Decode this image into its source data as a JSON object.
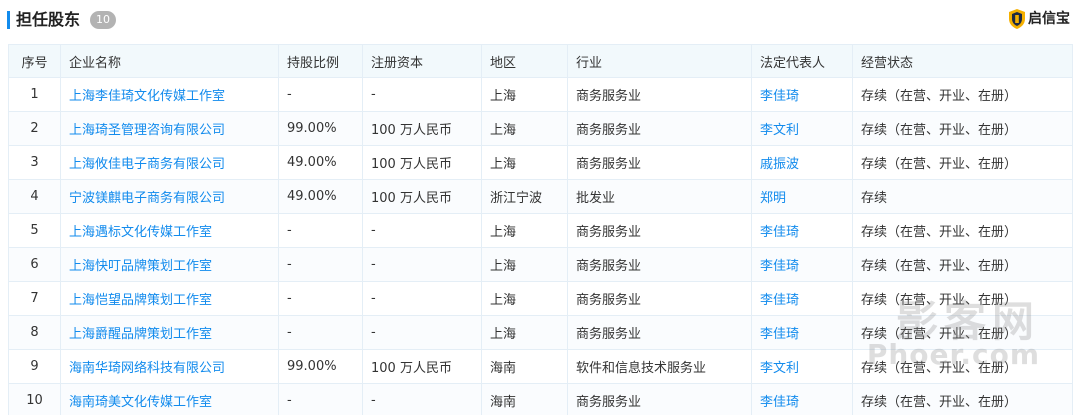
{
  "section": {
    "title": "担任股东",
    "count": "10"
  },
  "brand": {
    "name": "启信宝",
    "icon": "shield-icon",
    "color": "#f5b000"
  },
  "table": {
    "columns": [
      "序号",
      "企业名称",
      "持股比例",
      "注册资本",
      "地区",
      "行业",
      "法定代表人",
      "经营状态"
    ],
    "rows": [
      {
        "idx": "1",
        "company": "上海李佳琦文化传媒工作室",
        "ratio": "-",
        "capital": "-",
        "region": "上海",
        "industry": "商务服务业",
        "legal": "李佳琦",
        "status": "存续（在营、开业、在册）"
      },
      {
        "idx": "2",
        "company": "上海琦圣管理咨询有限公司",
        "ratio": "99.00%",
        "capital": "100 万人民币",
        "region": "上海",
        "industry": "商务服务业",
        "legal": "李文利",
        "status": "存续（在营、开业、在册）"
      },
      {
        "idx": "3",
        "company": "上海攸佳电子商务有限公司",
        "ratio": "49.00%",
        "capital": "100 万人民币",
        "region": "上海",
        "industry": "商务服务业",
        "legal": "戚振波",
        "status": "存续（在营、开业、在册）"
      },
      {
        "idx": "4",
        "company": "宁波镁麒电子商务有限公司",
        "ratio": "49.00%",
        "capital": "100 万人民币",
        "region": "浙江宁波",
        "industry": "批发业",
        "legal": "郑明",
        "status": "存续"
      },
      {
        "idx": "5",
        "company": "上海遇标文化传媒工作室",
        "ratio": "-",
        "capital": "-",
        "region": "上海",
        "industry": "商务服务业",
        "legal": "李佳琦",
        "status": "存续（在营、开业、在册）"
      },
      {
        "idx": "6",
        "company": "上海快叮品牌策划工作室",
        "ratio": "-",
        "capital": "-",
        "region": "上海",
        "industry": "商务服务业",
        "legal": "李佳琦",
        "status": "存续（在营、开业、在册）"
      },
      {
        "idx": "7",
        "company": "上海恺望品牌策划工作室",
        "ratio": "-",
        "capital": "-",
        "region": "上海",
        "industry": "商务服务业",
        "legal": "李佳琦",
        "status": "存续（在营、开业、在册）"
      },
      {
        "idx": "8",
        "company": "上海爵醒品牌策划工作室",
        "ratio": "-",
        "capital": "-",
        "region": "上海",
        "industry": "商务服务业",
        "legal": "李佳琦",
        "status": "存续（在营、开业、在册）"
      },
      {
        "idx": "9",
        "company": "海南华琦网络科技有限公司",
        "ratio": "99.00%",
        "capital": "100 万人民币",
        "region": "海南",
        "industry": "软件和信息技术服务业",
        "legal": "李文利",
        "status": "存续（在营、开业、在册）"
      },
      {
        "idx": "10",
        "company": "海南琦美文化传媒工作室",
        "ratio": "-",
        "capital": "-",
        "region": "海南",
        "industry": "商务服务业",
        "legal": "李佳琦",
        "status": "存续（在营、开业、在册）"
      }
    ]
  },
  "watermark": {
    "main": "影客网",
    "sub": "Phoer.com"
  },
  "colors": {
    "accent": "#128bed",
    "header_bg": "#f2f9fc",
    "border": "#e4eef6"
  }
}
